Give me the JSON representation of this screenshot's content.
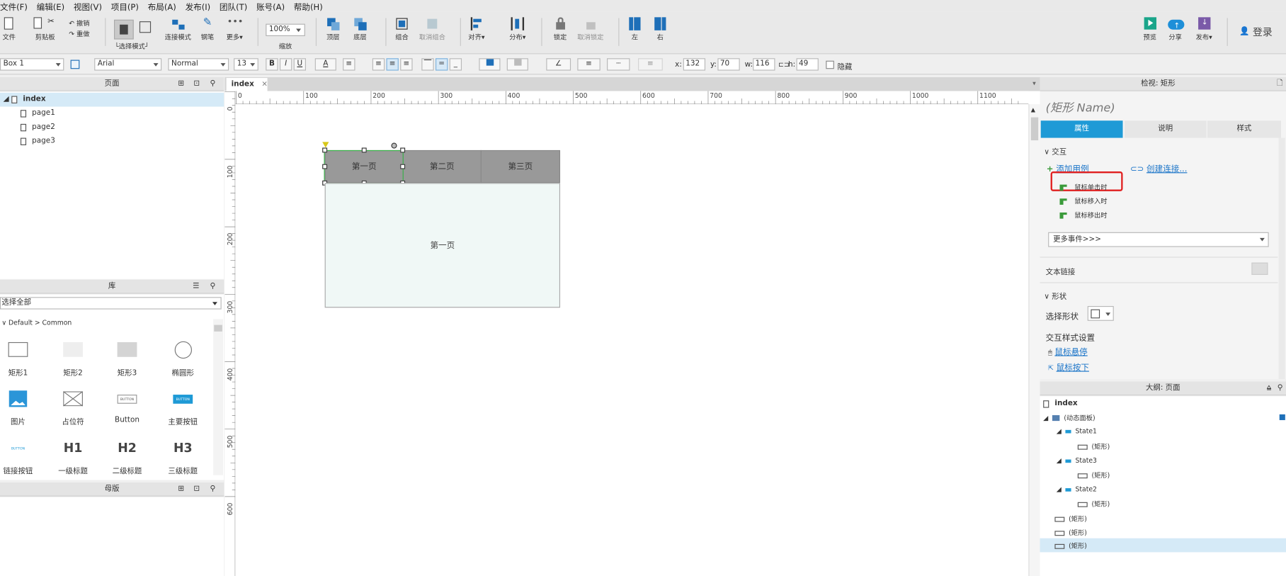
{
  "menu": [
    "文件(F)",
    "编辑(E)",
    "视图(V)",
    "项目(P)",
    "布局(A)",
    "发布(I)",
    "团队(T)",
    "账号(A)",
    "帮助(H)"
  ],
  "toolbar": {
    "file": "文件",
    "clipboard": "剪贴板",
    "undo": "撤销",
    "redo": "重做",
    "select_mode": "└选择模式┘",
    "connect_mode": "连接模式",
    "pen": "钢笔",
    "more": "更多▾",
    "zoom_value": "100%",
    "zoom_label": "缩放",
    "top": "顶层",
    "bottom": "底层",
    "group": "组合",
    "ungroup": "取消组合",
    "align": "对齐▾",
    "distribute": "分布▾",
    "lock": "锁定",
    "unlock": "取消锁定",
    "left": "左",
    "right": "右",
    "preview": "预览",
    "share": "分享",
    "publish": "发布▾",
    "login": "登录"
  },
  "format": {
    "widget_name": "Box 1",
    "font": "Arial",
    "style": "Normal",
    "size": "13",
    "bold": "B",
    "italic": "I",
    "underline": "U",
    "text_color": "A",
    "x_label": "x:",
    "x": "132",
    "y_label": "y:",
    "y": "70",
    "w_label": "w:",
    "w": "116",
    "h_label": "h:",
    "h": "49",
    "hidden": "隐藏"
  },
  "pages": {
    "title": "页面",
    "items": [
      "index",
      "page1",
      "page2",
      "page3"
    ]
  },
  "library": {
    "title": "库",
    "select": "选择全部",
    "group": "Default > Common",
    "items": [
      "矩形1",
      "矩形2",
      "矩形3",
      "椭圆形",
      "图片",
      "占位符",
      "Button",
      "主要按钮",
      "链接按钮",
      "一级标题",
      "二级标题",
      "三级标题"
    ],
    "btn_text": "BUTTON",
    "h1": "H1",
    "h2": "H2",
    "h3": "H3"
  },
  "masters": {
    "title": "母版"
  },
  "canvas": {
    "tab": "index",
    "close": "×",
    "hruler": [
      "0",
      "100",
      "200",
      "300",
      "400",
      "500",
      "600",
      "700",
      "800",
      "900",
      "1000",
      "1100"
    ],
    "vruler": [
      "0",
      "100",
      "200",
      "300",
      "400",
      "500",
      "600"
    ],
    "tabs": [
      "第一页",
      "第二页",
      "第三页"
    ],
    "content": "第一页"
  },
  "inspector": {
    "title": "检视: 矩形",
    "name_placeholder": "(矩形 Name)",
    "tabs": [
      "属性",
      "说明",
      "样式"
    ],
    "interaction": "交互",
    "add_case": "添加用例",
    "create_link": "创建连接...",
    "events": [
      "鼠标单击时",
      "鼠标移入时",
      "鼠标移出时"
    ],
    "more_events": "更多事件>>>",
    "text_link": "文本链接",
    "shape": "形状",
    "select_shape": "选择形状",
    "interaction_style": "交互样式设置",
    "hover": "鼠标悬停",
    "mouse_down": "鼠标按下"
  },
  "outline": {
    "title": "大纲: 页面",
    "root": "index",
    "items": [
      "(动态面板)",
      "State1",
      "(矩形)",
      "State3",
      "(矩形)",
      "State2",
      "(矩形)",
      "(矩形)",
      "(矩形)",
      "(矩形)"
    ]
  },
  "colors": {
    "accent": "#1e9ad6",
    "highlight": "#e02020"
  }
}
